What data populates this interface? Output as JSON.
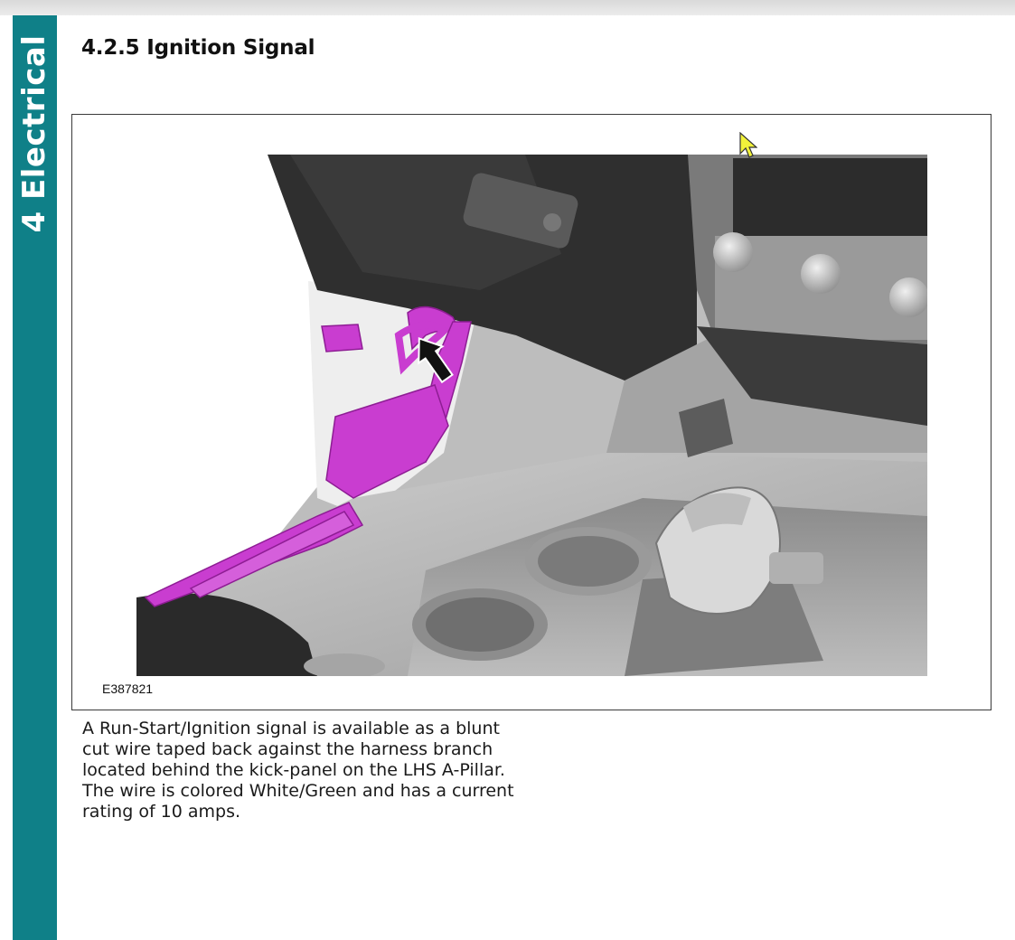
{
  "chapter": {
    "label": "4 Electrical",
    "color": "#0f8088"
  },
  "section": {
    "title": "4.2.5 Ignition Signal"
  },
  "figure": {
    "code": "E387821",
    "highlight_color": "#c93dd0",
    "content": "vehicle interior illustration with highlighted A-pillar harness and arrow"
  },
  "body": {
    "lines": [
      "A Run-Start/Ignition signal is available as a blunt",
      "cut wire taped back against the harness branch",
      "located behind the kick-panel on the LHS A-Pillar.",
      "The wire is colored White/Green and has a current",
      "rating of 10 amps."
    ]
  },
  "cursor": {
    "icon": "arrow-pointer-icon",
    "color": "#f2f23a"
  }
}
